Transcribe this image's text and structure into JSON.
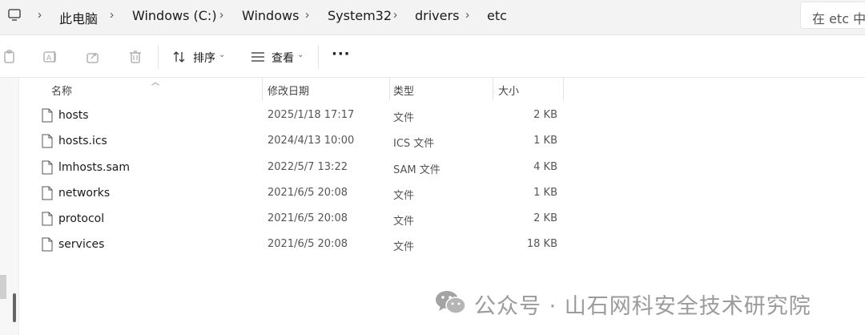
{
  "address_bar": {
    "breadcrumbs": [
      "此电脑",
      "Windows (C:)",
      "Windows",
      "System32",
      "drivers",
      "etc"
    ],
    "search_placeholder": "在 etc 中搜"
  },
  "toolbar": {
    "sort_label": "排序",
    "view_label": "查看",
    "more_label": "···"
  },
  "columns": {
    "name": "名称",
    "date": "修改日期",
    "type": "类型",
    "size": "大小"
  },
  "files": [
    {
      "name": "hosts",
      "date": "2025/1/18 17:17",
      "type": "文件",
      "size": "2 KB"
    },
    {
      "name": "hosts.ics",
      "date": "2024/4/13 10:00",
      "type": "ICS 文件",
      "size": "1 KB"
    },
    {
      "name": "lmhosts.sam",
      "date": "2022/5/7 13:22",
      "type": "SAM 文件",
      "size": "4 KB"
    },
    {
      "name": "networks",
      "date": "2021/6/5 20:08",
      "type": "文件",
      "size": "1 KB"
    },
    {
      "name": "protocol",
      "date": "2021/6/5 20:08",
      "type": "文件",
      "size": "2 KB"
    },
    {
      "name": "services",
      "date": "2021/6/5 20:08",
      "type": "文件",
      "size": "18 KB"
    }
  ],
  "watermark": {
    "text": "公众号 · 山石网科安全技术研究院"
  }
}
